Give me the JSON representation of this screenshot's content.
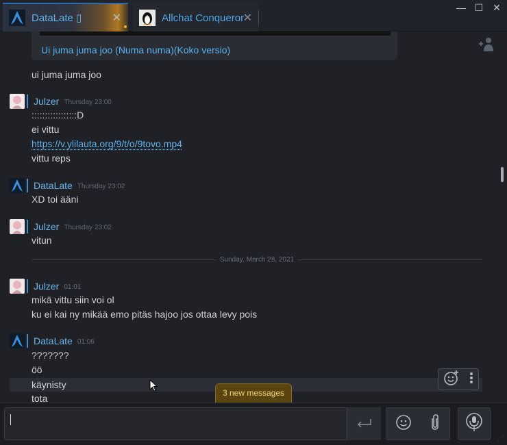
{
  "tabs": [
    {
      "label": "DataLate ▯",
      "close": "✕",
      "icon": "arch-logo-icon"
    },
    {
      "label": "Allchat Conqueror",
      "close": "✕",
      "icon": "tux-penguin-icon"
    }
  ],
  "window": {
    "minimize": "—",
    "maximize": "☐",
    "close": "✕"
  },
  "embed": {
    "title": "Ui juma juma joo (Numa numa)(Koko versio)"
  },
  "pre_lines": [
    "ui juma juma joo"
  ],
  "messages": [
    {
      "author": "Julzer",
      "time": "Thursday 23:00",
      "lines": [
        ":::::::::::::::::D",
        "ei vittu",
        "https://v.ylilauta.org/9/t/o/9tovo.mp4",
        "vittu reps"
      ]
    },
    {
      "author": "DataLate",
      "time": "Thursday 23:02",
      "lines": [
        "XD toi ääni"
      ]
    },
    {
      "author": "Julzer",
      "time": "Thursday 23:02",
      "lines": [
        "vitun"
      ]
    },
    {
      "author": "Julzer",
      "time": "01:01",
      "lines": [
        "mikä vittu siin voi ol",
        "ku ei kai ny mikää emo pitäs hajoo jos ottaa levy pois"
      ]
    },
    {
      "author": "DataLate",
      "time": "01:06",
      "lines": [
        "???????",
        "öö",
        "käynisty",
        "tota"
      ]
    }
  ],
  "date_separator": "Sunday, March 28, 2021",
  "new_messages_badge": "3 new messages",
  "composer": {
    "value": ""
  },
  "colors": {
    "accent": "#5fb2ea",
    "badge": "#5a4410",
    "badge_text": "#f3d27a"
  }
}
